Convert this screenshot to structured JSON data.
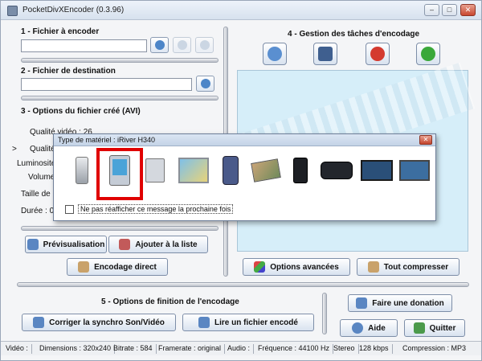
{
  "window": {
    "title": "PocketDivXEncoder (0.3.96)",
    "controls": {
      "minimize": "–",
      "maximize": "□",
      "close": "✕"
    }
  },
  "sections": {
    "source": {
      "title": "1 - Fichier à encoder",
      "value": ""
    },
    "destination": {
      "title": "2 - Fichier de destination",
      "value": ""
    },
    "options": {
      "title": "3 - Options du fichier créé (AVI)",
      "labels": {
        "video_quality": "Qualité vidéo : 26",
        "audio_quality": "Qualité",
        "brightness": "Luminosité",
        "volume": "Volume",
        "file_size": "Taille de",
        "duration": "Durée : 00"
      },
      "marker": ">"
    },
    "tasks": {
      "title": "4 - Gestion des tâches d'encodage"
    },
    "finish": {
      "title": "5 - Options de finition de l'encodage"
    }
  },
  "buttons": {
    "preview": "Prévisualisation",
    "add_to_list": "Ajouter à la liste",
    "direct_encode": "Encodage direct",
    "advanced": "Options avancées",
    "compress_all": "Tout compresser",
    "fix_sync": "Corriger la synchro Son/Vidéo",
    "play_file": "Lire un fichier encodé",
    "donate": "Faire une donation",
    "help": "Aide",
    "quit": "Quitter"
  },
  "dialog": {
    "title": "Type de matériel : iRiver H340",
    "close": "✕",
    "devices": [
      "pda-silver",
      "pda-selected",
      "pda-screen",
      "desktop-monitor",
      "pocket-pc",
      "photo-viewer",
      "media-player-black",
      "portable-video-player",
      "tv-widescreen",
      "lcd-monitor"
    ],
    "checkbox_label": "Ne pas réafficher ce message la prochaine fois",
    "checked": false
  },
  "status": {
    "video": "Vidéo :",
    "dimensions": "Dimensions : 320x240",
    "bitrate": "Bitrate : 584",
    "framerate": "Framerate : original",
    "audio": "Audio :",
    "frequency": "Fréquence : 44100 Hz",
    "stereo": "Stereo",
    "kbps": "128 kbps",
    "compression": "Compression : MP3"
  },
  "colors": {
    "accent": "#4d86c8",
    "selection": "#e00000",
    "task_area": "#d6eef9"
  }
}
